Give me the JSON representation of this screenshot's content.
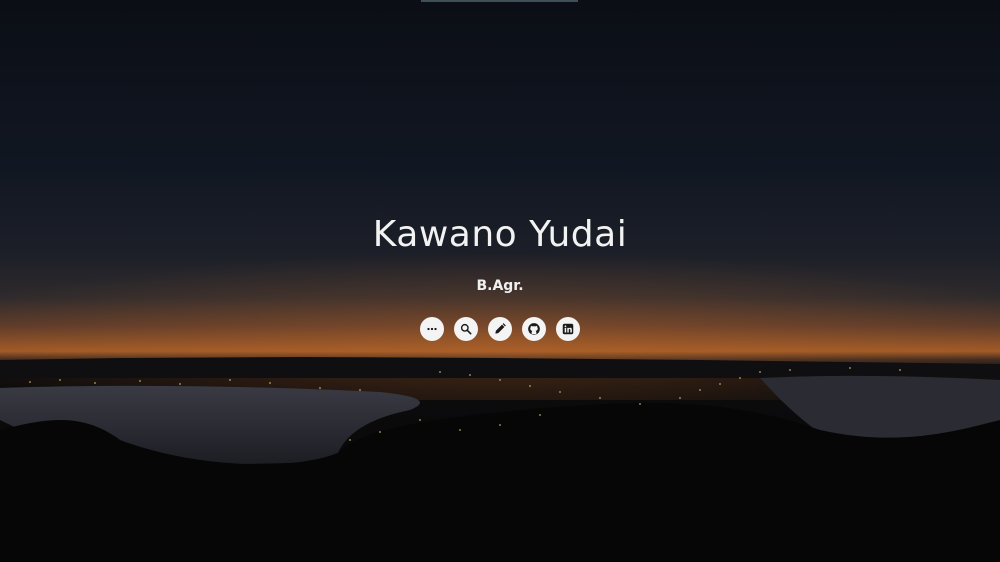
{
  "hero": {
    "title": "Kawano Yudai",
    "subtitle": "B.Agr."
  },
  "social_links": [
    {
      "icon": "more-horizontal-icon"
    },
    {
      "icon": "search-icon"
    },
    {
      "icon": "pencil-icon"
    },
    {
      "icon": "github-icon"
    },
    {
      "icon": "linkedin-icon"
    }
  ],
  "colors": {
    "background_dark": "#0b0e14",
    "horizon_orange": "#c26a2a",
    "text": "#ffffff",
    "icon_bg": "#f4f4f4",
    "icon_fg": "#1a1a1a"
  }
}
